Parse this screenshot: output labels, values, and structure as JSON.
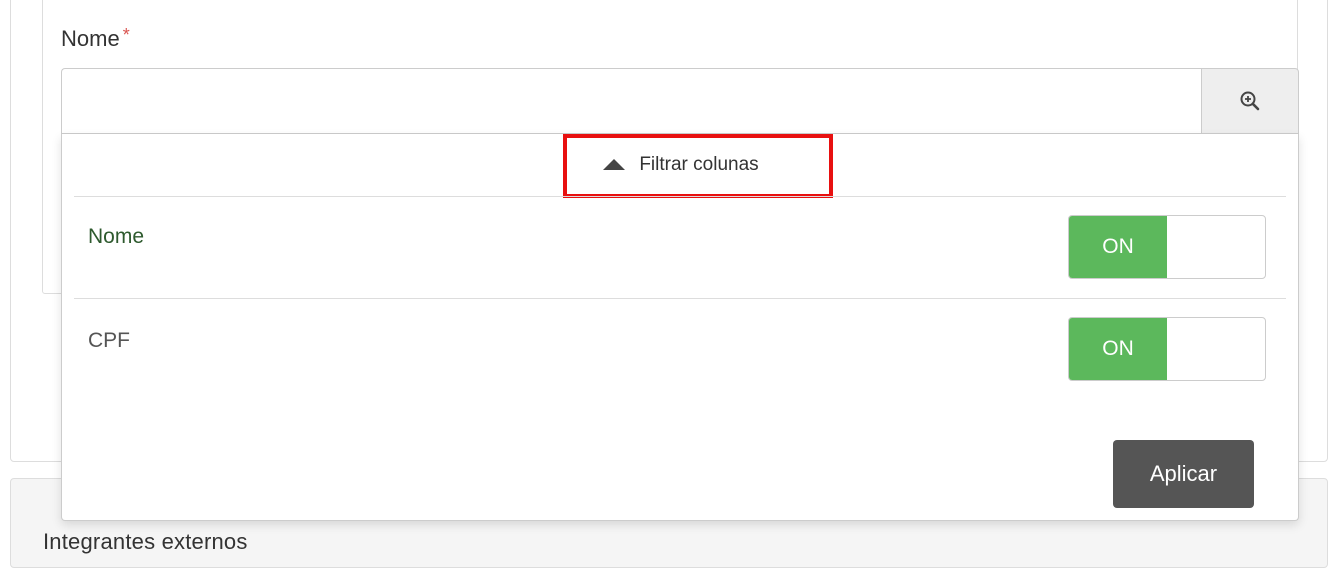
{
  "field": {
    "label": "Nome",
    "required_mark": "*",
    "input_value": "",
    "input_placeholder": "",
    "search_icon": "zoom-in-icon"
  },
  "filter": {
    "toggle_label": "Filtrar colunas",
    "toggle_icon": "caret-up-icon",
    "highlight_color": "#e81010"
  },
  "columns": [
    {
      "label": "Nome",
      "switch_label": "ON",
      "label_color": "#2e5a2e"
    },
    {
      "label": "CPF",
      "switch_label": "ON",
      "label_color": "#555555"
    }
  ],
  "apply_label": "Aplicar",
  "next_section_title": "Integrantes externos",
  "colors": {
    "switch_on": "#5cb85c",
    "apply_button": "#555555",
    "required": "#d9534f"
  }
}
